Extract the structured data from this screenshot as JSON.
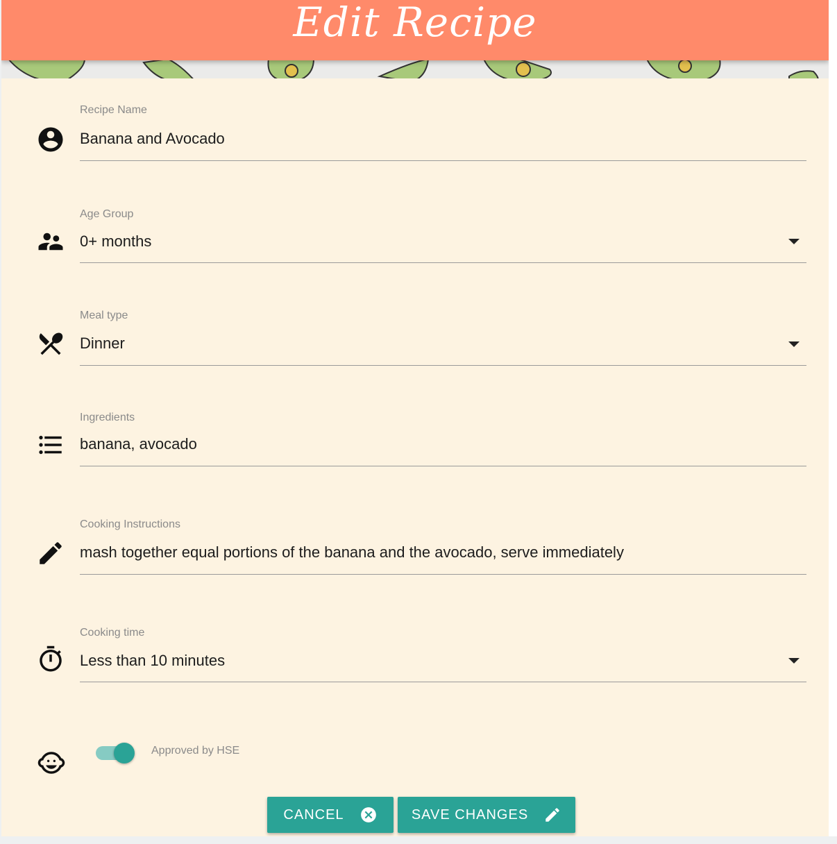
{
  "header": {
    "title": "Edit Recipe"
  },
  "form": {
    "recipe_name": {
      "label": "Recipe Name",
      "value": "Banana and Avocado",
      "icon": "account-circle-icon"
    },
    "age_group": {
      "label": "Age Group",
      "value": "0+ months",
      "icon": "people-icon"
    },
    "meal_type": {
      "label": "Meal type",
      "value": "Dinner",
      "icon": "utensils-icon"
    },
    "ingredients": {
      "label": "Ingredients",
      "value": "banana, avocado",
      "icon": "list-icon"
    },
    "cooking_instructions": {
      "label": "Cooking Instructions",
      "value": "mash together equal portions of the banana and the avocado, serve immediately",
      "icon": "pencil-icon"
    },
    "cooking_time": {
      "label": "Cooking time",
      "value": "Less than 10 minutes",
      "icon": "timer-icon"
    },
    "approved": {
      "label": "Approved by HSE",
      "checked": true,
      "icon": "baby-face-icon"
    }
  },
  "actions": {
    "cancel_label": "CANCEL",
    "save_label": "SAVE CHANGES"
  },
  "colors": {
    "header": "#ff8a6a",
    "background": "#fdf3e1",
    "accent": "#2aa396",
    "accent_light": "#86cbc3"
  }
}
